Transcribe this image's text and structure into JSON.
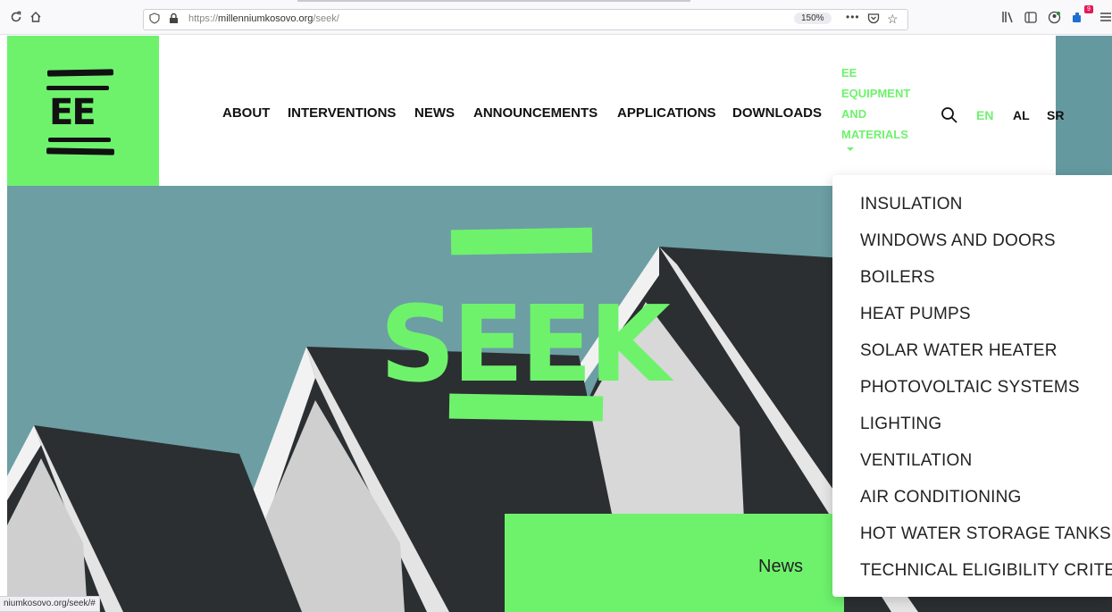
{
  "browser": {
    "url_prefix": "https://",
    "url_domain": "millenniumkosovo.org",
    "url_path": "/seek/",
    "zoom": "150%",
    "status_url": "niumkosovo.org/seek/#",
    "notification_count": "9"
  },
  "site": {
    "logo_text": "EE",
    "nav": {
      "about": "ABOUT",
      "interventions": "INTERVENTIONS",
      "news": "NEWS",
      "announcements": "ANNOUNCEMENTS",
      "applications": "APPLICATIONS",
      "downloads": "DOWNLOADS",
      "ee_line1": "EE",
      "ee_line2": "EQUIPMENT",
      "ee_line3": "AND",
      "ee_line4": "MATERIALS"
    },
    "languages": {
      "en": "EN",
      "al": "AL",
      "sr": "SR"
    },
    "hero_title": "SEEK",
    "news_label": "News",
    "dropdown": [
      "INSULATION",
      "WINDOWS AND DOORS",
      "BOILERS",
      "HEAT PUMPS",
      "SOLAR WATER HEATER",
      "PHOTOVOLTAIC SYSTEMS",
      "LIGHTING",
      "VENTILATION",
      "AIR CONDITIONING",
      "HOT WATER STORAGE TANKS",
      "TECHNICAL ELIGIBILITY CRITERIA"
    ]
  },
  "colors": {
    "brand_green": "#6ef26c",
    "hero_sky": "#6c9ea4",
    "roof_dark": "#2b2f31",
    "text_dark": "#111111"
  }
}
